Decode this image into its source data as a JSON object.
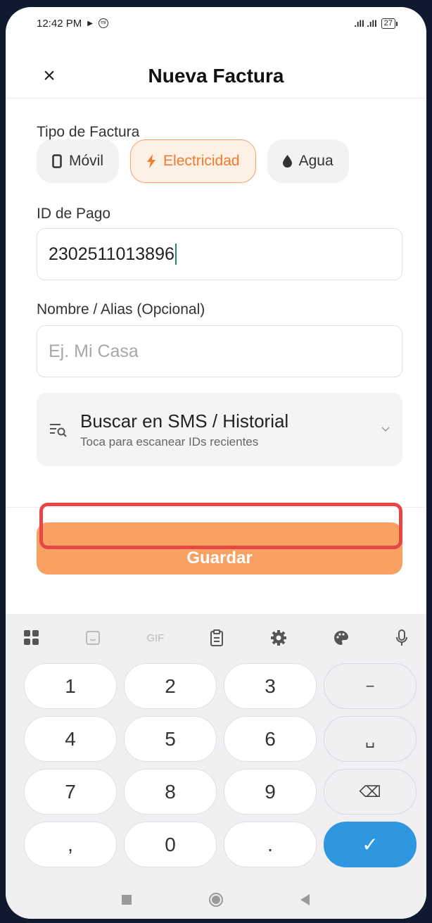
{
  "status_bar": {
    "time": "12:42 PM",
    "play_icon": "▶",
    "mi_label": "mi",
    "signal": ".ıll .ıll",
    "battery": "27"
  },
  "header": {
    "close_icon": "×",
    "title": "Nueva Factura"
  },
  "form": {
    "bill_type_label": "Tipo de Factura",
    "chips": [
      {
        "label": "Móvil",
        "icon": "mobile-icon",
        "active": false
      },
      {
        "label": "Electricidad",
        "icon": "bolt-icon",
        "active": true
      },
      {
        "label": "Agua",
        "icon": "drop-icon",
        "active": false
      }
    ],
    "payment_id_label": "ID de Pago",
    "payment_id_value": "2302511013896",
    "alias_label": "Nombre / Alias (Opcional)",
    "alias_placeholder": "Ej. Mi Casa",
    "sms_search": {
      "title": "Buscar en SMS / Historial",
      "subtitle": "Toca para escanear IDs recientes"
    },
    "save_label": "Guardar"
  },
  "colors": {
    "accent": "#f07b30",
    "save_button": "#f8a162",
    "highlight": "#e84545",
    "enter_key": "#2f97e0"
  },
  "keyboard": {
    "toolbar_gif": "GIF",
    "rows": [
      [
        "1",
        "2",
        "3",
        "−"
      ],
      [
        "4",
        "5",
        "6",
        "␣"
      ],
      [
        "7",
        "8",
        "9",
        "⌫"
      ],
      [
        ",",
        "0",
        ".",
        "✓"
      ]
    ]
  }
}
